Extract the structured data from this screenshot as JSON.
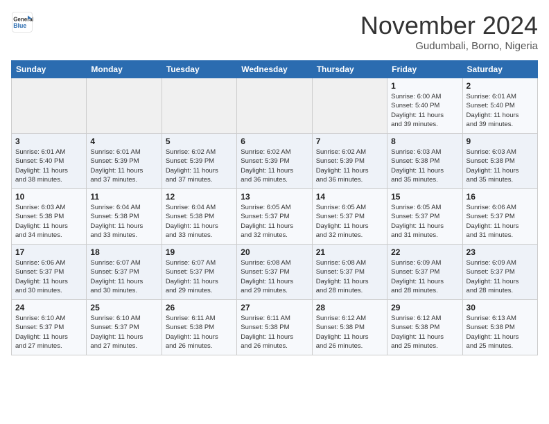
{
  "header": {
    "logo_text_top": "General",
    "logo_text_bottom": "Blue",
    "month": "November 2024",
    "location": "Gudumbali, Borno, Nigeria"
  },
  "weekdays": [
    "Sunday",
    "Monday",
    "Tuesday",
    "Wednesday",
    "Thursday",
    "Friday",
    "Saturday"
  ],
  "weeks": [
    [
      {
        "day": "",
        "info": ""
      },
      {
        "day": "",
        "info": ""
      },
      {
        "day": "",
        "info": ""
      },
      {
        "day": "",
        "info": ""
      },
      {
        "day": "",
        "info": ""
      },
      {
        "day": "1",
        "info": "Sunrise: 6:00 AM\nSunset: 5:40 PM\nDaylight: 11 hours\nand 39 minutes."
      },
      {
        "day": "2",
        "info": "Sunrise: 6:01 AM\nSunset: 5:40 PM\nDaylight: 11 hours\nand 39 minutes."
      }
    ],
    [
      {
        "day": "3",
        "info": "Sunrise: 6:01 AM\nSunset: 5:40 PM\nDaylight: 11 hours\nand 38 minutes."
      },
      {
        "day": "4",
        "info": "Sunrise: 6:01 AM\nSunset: 5:39 PM\nDaylight: 11 hours\nand 37 minutes."
      },
      {
        "day": "5",
        "info": "Sunrise: 6:02 AM\nSunset: 5:39 PM\nDaylight: 11 hours\nand 37 minutes."
      },
      {
        "day": "6",
        "info": "Sunrise: 6:02 AM\nSunset: 5:39 PM\nDaylight: 11 hours\nand 36 minutes."
      },
      {
        "day": "7",
        "info": "Sunrise: 6:02 AM\nSunset: 5:39 PM\nDaylight: 11 hours\nand 36 minutes."
      },
      {
        "day": "8",
        "info": "Sunrise: 6:03 AM\nSunset: 5:38 PM\nDaylight: 11 hours\nand 35 minutes."
      },
      {
        "day": "9",
        "info": "Sunrise: 6:03 AM\nSunset: 5:38 PM\nDaylight: 11 hours\nand 35 minutes."
      }
    ],
    [
      {
        "day": "10",
        "info": "Sunrise: 6:03 AM\nSunset: 5:38 PM\nDaylight: 11 hours\nand 34 minutes."
      },
      {
        "day": "11",
        "info": "Sunrise: 6:04 AM\nSunset: 5:38 PM\nDaylight: 11 hours\nand 33 minutes."
      },
      {
        "day": "12",
        "info": "Sunrise: 6:04 AM\nSunset: 5:38 PM\nDaylight: 11 hours\nand 33 minutes."
      },
      {
        "day": "13",
        "info": "Sunrise: 6:05 AM\nSunset: 5:37 PM\nDaylight: 11 hours\nand 32 minutes."
      },
      {
        "day": "14",
        "info": "Sunrise: 6:05 AM\nSunset: 5:37 PM\nDaylight: 11 hours\nand 32 minutes."
      },
      {
        "day": "15",
        "info": "Sunrise: 6:05 AM\nSunset: 5:37 PM\nDaylight: 11 hours\nand 31 minutes."
      },
      {
        "day": "16",
        "info": "Sunrise: 6:06 AM\nSunset: 5:37 PM\nDaylight: 11 hours\nand 31 minutes."
      }
    ],
    [
      {
        "day": "17",
        "info": "Sunrise: 6:06 AM\nSunset: 5:37 PM\nDaylight: 11 hours\nand 30 minutes."
      },
      {
        "day": "18",
        "info": "Sunrise: 6:07 AM\nSunset: 5:37 PM\nDaylight: 11 hours\nand 30 minutes."
      },
      {
        "day": "19",
        "info": "Sunrise: 6:07 AM\nSunset: 5:37 PM\nDaylight: 11 hours\nand 29 minutes."
      },
      {
        "day": "20",
        "info": "Sunrise: 6:08 AM\nSunset: 5:37 PM\nDaylight: 11 hours\nand 29 minutes."
      },
      {
        "day": "21",
        "info": "Sunrise: 6:08 AM\nSunset: 5:37 PM\nDaylight: 11 hours\nand 28 minutes."
      },
      {
        "day": "22",
        "info": "Sunrise: 6:09 AM\nSunset: 5:37 PM\nDaylight: 11 hours\nand 28 minutes."
      },
      {
        "day": "23",
        "info": "Sunrise: 6:09 AM\nSunset: 5:37 PM\nDaylight: 11 hours\nand 28 minutes."
      }
    ],
    [
      {
        "day": "24",
        "info": "Sunrise: 6:10 AM\nSunset: 5:37 PM\nDaylight: 11 hours\nand 27 minutes."
      },
      {
        "day": "25",
        "info": "Sunrise: 6:10 AM\nSunset: 5:37 PM\nDaylight: 11 hours\nand 27 minutes."
      },
      {
        "day": "26",
        "info": "Sunrise: 6:11 AM\nSunset: 5:38 PM\nDaylight: 11 hours\nand 26 minutes."
      },
      {
        "day": "27",
        "info": "Sunrise: 6:11 AM\nSunset: 5:38 PM\nDaylight: 11 hours\nand 26 minutes."
      },
      {
        "day": "28",
        "info": "Sunrise: 6:12 AM\nSunset: 5:38 PM\nDaylight: 11 hours\nand 26 minutes."
      },
      {
        "day": "29",
        "info": "Sunrise: 6:12 AM\nSunset: 5:38 PM\nDaylight: 11 hours\nand 25 minutes."
      },
      {
        "day": "30",
        "info": "Sunrise: 6:13 AM\nSunset: 5:38 PM\nDaylight: 11 hours\nand 25 minutes."
      }
    ]
  ]
}
